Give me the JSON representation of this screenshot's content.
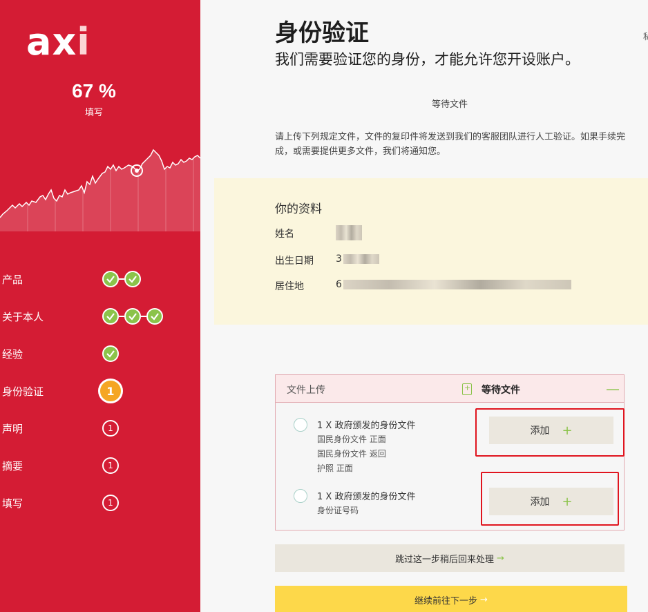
{
  "sidebar": {
    "logo_main": "ax",
    "logo_accent": "i",
    "progress": {
      "value": "67 %",
      "label": "填写",
      "fraction": 0.67
    },
    "colors": {
      "background": "#d41c34",
      "check": "#8bc34a",
      "active": "#f5a623"
    },
    "steps": [
      {
        "label": "产品",
        "status": "done",
        "checks": 2
      },
      {
        "label": "关于本人",
        "status": "done",
        "checks": 3
      },
      {
        "label": "经验",
        "status": "done",
        "checks": 1
      },
      {
        "label": "身份验证",
        "status": "active",
        "count": "1"
      },
      {
        "label": "声明",
        "status": "pending",
        "count": "1"
      },
      {
        "label": "摘要",
        "status": "pending",
        "count": "1"
      },
      {
        "label": "填写",
        "status": "pending",
        "count": "1"
      }
    ]
  },
  "main": {
    "title": "身份验证",
    "subtitle": "我们需要验证您的身份，才能允许您开设账户。",
    "corner_text": "私",
    "status_text": "等待文件",
    "description": "请上传下列规定文件，文件的复印件将发送到我们的客服团队进行人工验证。如果手续完成，或需要提供更多文件，我们将通知您。",
    "info": {
      "title": "你的资料",
      "rows": [
        {
          "label": "姓名",
          "value": ""
        },
        {
          "label": "出生日期",
          "value": "3"
        },
        {
          "label": "居住地",
          "value": "6"
        }
      ]
    },
    "upload": {
      "label": "文件上传",
      "status": "等待文件",
      "collapse_icon": "minus-icon",
      "doc_icon": "document-add-icon",
      "requirements": [
        {
          "title": "1 X 政府颁发的身份文件",
          "items": [
            "国民身份文件  正面",
            "国民身份文件  返回",
            "护照  正面"
          ],
          "button": "添加"
        },
        {
          "title": "1 X 政府颁发的身份文件",
          "items": [
            "身份证号码"
          ],
          "button": "添加"
        }
      ]
    },
    "skip_button": "跳过这一步稍后回来处理",
    "next_button": "继续前往下一步",
    "colors": {
      "info_bg": "#fbf6dd",
      "upload_border": "#e2a9b0",
      "next_bg": "#fdd84a",
      "highlight": "#e0141e"
    }
  }
}
